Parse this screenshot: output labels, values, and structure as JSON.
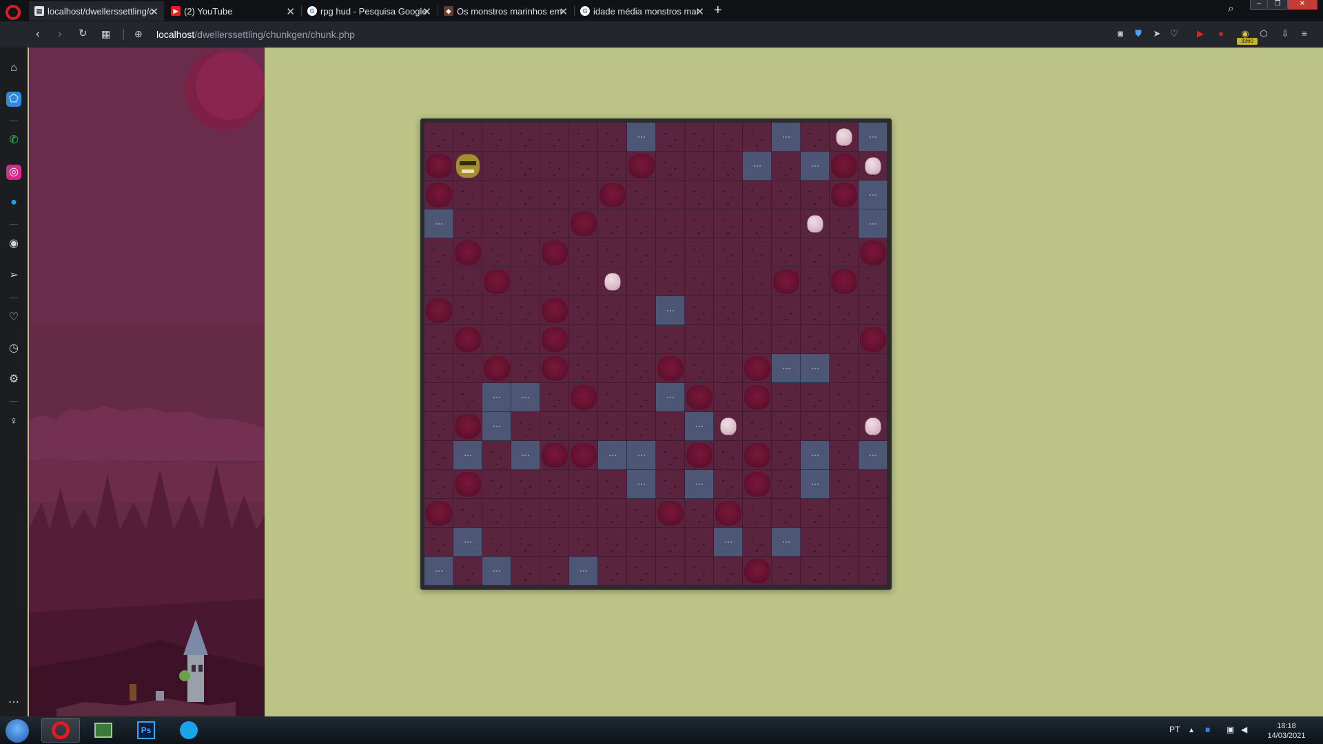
{
  "tabs": [
    {
      "title": "localhost/dwellerssettling/c",
      "favicon": "page-icon",
      "active": true
    },
    {
      "title": "(2) YouTube",
      "favicon": "youtube-icon",
      "active": false
    },
    {
      "title": "rpg hud - Pesquisa Google",
      "favicon": "google-icon",
      "active": false
    },
    {
      "title": "Os monstros marinhos em",
      "favicon": "page-icon",
      "active": false
    },
    {
      "title": "idade média monstros mar",
      "favicon": "google-icon",
      "active": false
    }
  ],
  "toolbar": {
    "address_host": "localhost",
    "address_path": "/dwellerssettling/chunkgen/chunk.php",
    "badge_count": "3360"
  },
  "sidebar": {
    "items": [
      "home-icon",
      "speed-dial-icon",
      "whatsapp-icon",
      "instagram-icon",
      "twitter-icon",
      "player-icon",
      "send-icon",
      "heart-icon",
      "history-icon",
      "settings-icon",
      "bulb-icon",
      "more-icon"
    ]
  },
  "game": {
    "legend": {
      ".": "floor",
      "W": "water",
      "T": "tree",
      "R": "rock",
      "O": "orc"
    },
    "rows": [
      ".......W....W.RW",
      "TO.....T...W.WTR",
      "T.....T.......TW",
      "W....T.......R.W",
      ".T..T..........T",
      "..T...R.....T.T.",
      "T...T...W.......",
      ".T..T..........T",
      "..T.T...T..TWW..",
      "..WW.T..WT.T....",
      ".TW......WR....R",
      ".W.WTTWW.T.T.W.W",
      ".T.....W.W.T.W..",
      "T.......T.T.....",
      ".W........W.W...",
      "W.W..W.....T...."
    ]
  },
  "taskbar": {
    "language": "PT",
    "time": "18:18",
    "date": "14/03/2021"
  }
}
